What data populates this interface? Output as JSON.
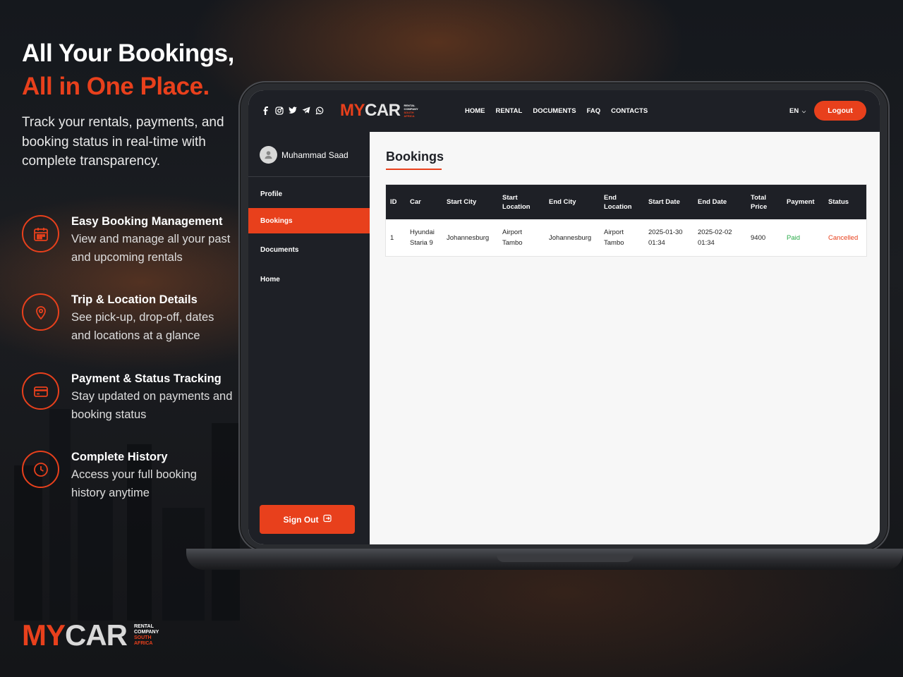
{
  "hero": {
    "title_line1": "All Your Bookings,",
    "title_line2": "All in One Place.",
    "subtitle": "Track your rentals, payments, and booking status in real-time with complete transparency."
  },
  "features": [
    {
      "icon": "calendar-icon",
      "title": "Easy Booking Management",
      "desc": "View and manage all your past and upcoming rentals"
    },
    {
      "icon": "location-pin-icon",
      "title": "Trip & Location Details",
      "desc": "See pick-up, drop-off, dates and locations at a glance"
    },
    {
      "icon": "credit-card-icon",
      "title": "Payment & Status Tracking",
      "desc": "Stay updated on payments and booking status"
    },
    {
      "icon": "clock-icon",
      "title": "Complete History",
      "desc": "Access your full booking history anytime"
    }
  ],
  "brand": {
    "my": "MY",
    "car": "CAR",
    "tag_line1": "RENTAL",
    "tag_line2": "COMPANY",
    "tag_line3": "SOUTH",
    "tag_line4": "AFRICA"
  },
  "colors": {
    "accent": "#e8401c",
    "dark": "#1e2026",
    "paid": "#2bab4a"
  },
  "app": {
    "social_icons": [
      "facebook-icon",
      "instagram-icon",
      "twitter-icon",
      "telegram-icon",
      "whatsapp-icon"
    ],
    "nav": [
      "HOME",
      "RENTAL",
      "DOCUMENTS",
      "FAQ",
      "CONTACTS"
    ],
    "language": "EN",
    "logout_label": "Logout",
    "user_name": "Muhammad Saad",
    "sidebar_items": [
      "Profile",
      "Bookings",
      "Documents",
      "Home"
    ],
    "active_sidebar": "Bookings",
    "signout_label": "Sign Out",
    "page_title": "Bookings",
    "table": {
      "headers": [
        "ID",
        "Car",
        "Start City",
        "Start Location",
        "End City",
        "End Location",
        "Start Date",
        "End Date",
        "Total Price",
        "Payment",
        "Status"
      ],
      "rows": [
        {
          "id": "1",
          "car": "Hyundai Staria 9",
          "start_city": "Johannesburg",
          "start_location": "Airport Tambo",
          "end_city": "Johannesburg",
          "end_location": "Airport Tambo",
          "start_date": "2025-01-30 01:34",
          "end_date": "2025-02-02 01:34",
          "total_price": "9400",
          "payment": "Paid",
          "status": "Cancelled"
        }
      ]
    }
  }
}
